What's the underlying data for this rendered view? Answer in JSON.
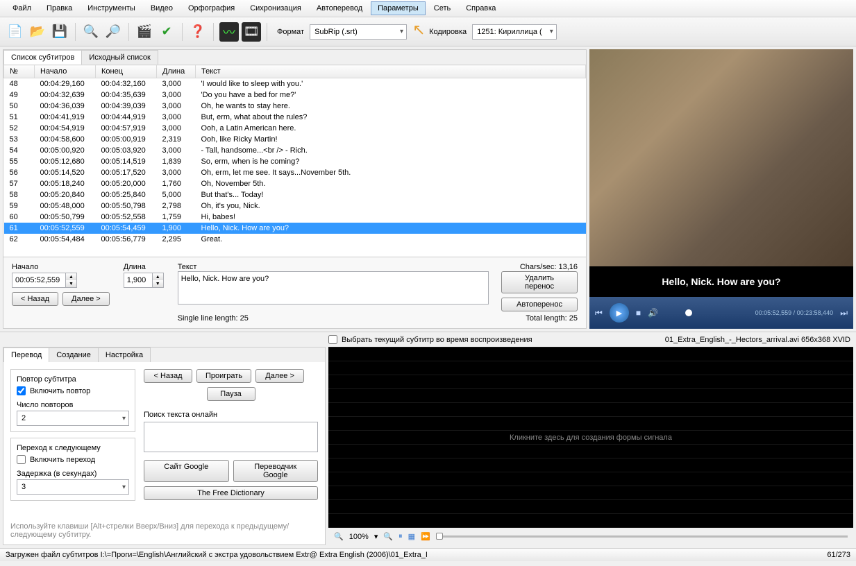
{
  "menu": {
    "items": [
      "Файл",
      "Правка",
      "Инструменты",
      "Видео",
      "Орфография",
      "Сихронизация",
      "Автоперевод",
      "Параметры",
      "Сеть",
      "Справка"
    ],
    "active_index": 7
  },
  "toolbar": {
    "format_label": "Формат",
    "format_value": "SubRip (.srt)",
    "encoding_label": "Кодировка",
    "encoding_value": "1251: Кириллица ("
  },
  "tabs_top": {
    "list": "Список субтитров",
    "source": "Исходный список"
  },
  "columns": {
    "num": "№",
    "start": "Начало",
    "end": "Конец",
    "dur": "Длина",
    "text": "Текст"
  },
  "rows": [
    {
      "n": "48",
      "s": "00:04:29,160",
      "e": "00:04:32,160",
      "d": "3,000",
      "t": "'I would like to sleep with you.'"
    },
    {
      "n": "49",
      "s": "00:04:32,639",
      "e": "00:04:35,639",
      "d": "3,000",
      "t": "'Do you have a bed for me?'"
    },
    {
      "n": "50",
      "s": "00:04:36,039",
      "e": "00:04:39,039",
      "d": "3,000",
      "t": "Oh, he wants to stay here."
    },
    {
      "n": "51",
      "s": "00:04:41,919",
      "e": "00:04:44,919",
      "d": "3,000",
      "t": "But, erm, what about the rules?"
    },
    {
      "n": "52",
      "s": "00:04:54,919",
      "e": "00:04:57,919",
      "d": "3,000",
      "t": "Ooh, a Latin American here."
    },
    {
      "n": "53",
      "s": "00:04:58,600",
      "e": "00:05:00,919",
      "d": "2,319",
      "t": "Ooh, like Ricky Martin!"
    },
    {
      "n": "54",
      "s": "00:05:00,920",
      "e": "00:05:03,920",
      "d": "3,000",
      "t": "- Tall, handsome...<br /> - Rich."
    },
    {
      "n": "55",
      "s": "00:05:12,680",
      "e": "00:05:14,519",
      "d": "1,839",
      "t": "So, erm, when is he coming?"
    },
    {
      "n": "56",
      "s": "00:05:14,520",
      "e": "00:05:17,520",
      "d": "3,000",
      "t": "Oh, erm, let me see. It says...November 5th."
    },
    {
      "n": "57",
      "s": "00:05:18,240",
      "e": "00:05:20,000",
      "d": "1,760",
      "t": "Oh, November 5th."
    },
    {
      "n": "58",
      "s": "00:05:20,840",
      "e": "00:05:25,840",
      "d": "5,000",
      "t": "But that's... Today!"
    },
    {
      "n": "59",
      "s": "00:05:48,000",
      "e": "00:05:50,798",
      "d": "2,798",
      "t": "Oh, it's you, Nick."
    },
    {
      "n": "60",
      "s": "00:05:50,799",
      "e": "00:05:52,558",
      "d": "1,759",
      "t": "Hi, babes!"
    },
    {
      "n": "61",
      "s": "00:05:52,559",
      "e": "00:05:54,459",
      "d": "1,900",
      "t": "Hello, Nick. How are you?",
      "sel": true
    },
    {
      "n": "62",
      "s": "00:05:54,484",
      "e": "00:05:56,779",
      "d": "2,295",
      "t": "Great."
    }
  ],
  "edit": {
    "start_label": "Начало",
    "start_value": "00:05:52,559",
    "dur_label": "Длина",
    "dur_value": "1,900",
    "text_label": "Текст",
    "text_value": "Hello, Nick. How are you?",
    "cps_label": "Chars/sec: 13,16",
    "single_len": "Single line length:  25",
    "total_len": "Total length:  25",
    "btn_back": "< Назад",
    "btn_fwd": "Далее >",
    "btn_unbreak": "Удалить перенос",
    "btn_autobreak": "Автоперенос"
  },
  "video": {
    "subtitle": "Hello, Nick. How are you?",
    "time": "00:05:52,559 / 00:23:58,440",
    "select_current": "Выбрать текущий субтитр во время воспроизведения",
    "filename": "01_Extra_English_-_Hectors_arrival.avi 656x368 XVID"
  },
  "tabs_bottom": {
    "trans": "Перевод",
    "create": "Создание",
    "adjust": "Настройка"
  },
  "translate": {
    "repeat_title": "Повтор субтитра",
    "enable_repeat": "Включить повтор",
    "repeat_count_label": "Число повторов",
    "repeat_count_value": "2",
    "next_title": "Переход к следующему",
    "enable_next": "Включить переход",
    "delay_label": "Задержка (в секундах)",
    "delay_value": "3",
    "btn_back": "< Назад",
    "btn_play": "Проиграть",
    "btn_fwd": "Далее >",
    "btn_pause": "Пауза",
    "search_label": "Поиск текста онлайн",
    "btn_google": "Сайт Google",
    "btn_gtrans": "Переводчик Google",
    "btn_dict": "The Free Dictionary",
    "hint": "Используйте клавиши [Alt+стрелки Вверх/Вниз] для перехода к предыдущему/следующему субтитру."
  },
  "waveform": {
    "placeholder": "Кликните здесь для создания формы сигнала"
  },
  "zoom": {
    "pct": "100%"
  },
  "status": {
    "left": "Загружен файл субтитров I:\\=Проги=\\English\\Английский с экстра удовольствием  Extr@  Extra English (2006)\\01_Extra_I",
    "right": "61/273"
  }
}
